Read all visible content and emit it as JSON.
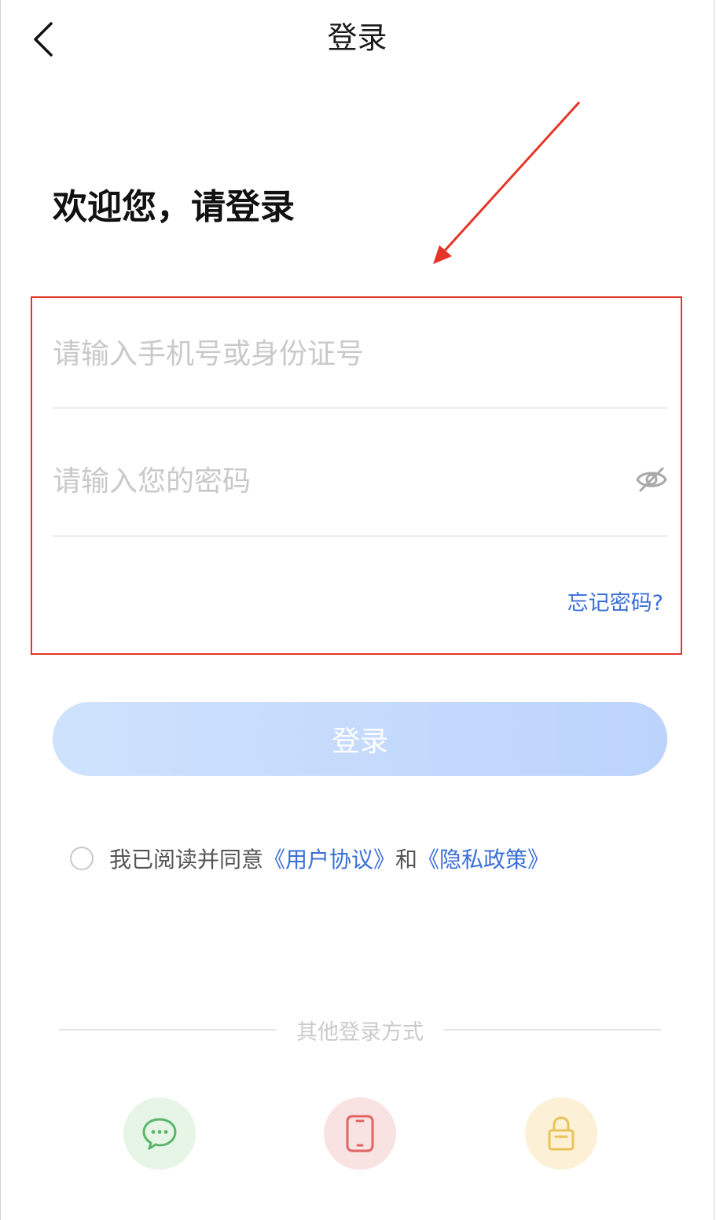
{
  "nav": {
    "title": "登录"
  },
  "welcome_text": "欢迎您，请登录",
  "form": {
    "phone_placeholder": "请输入手机号或身份证号",
    "phone_value": "",
    "password_placeholder": "请输入您的密码",
    "password_value": "",
    "forgot_label": "忘记密码?",
    "login_label": "登录"
  },
  "agreement": {
    "prefix": "我已阅读并同意",
    "user_agreement": "《用户协议》",
    "conjunction": "和",
    "privacy_policy": "《隐私政策》"
  },
  "other_login": {
    "label": "其他登录方式",
    "methods": [
      {
        "icon": "wechat-icon",
        "bg": "#e6f5e6",
        "color": "#5ab66b"
      },
      {
        "icon": "phone-icon",
        "bg": "#f9e2e2",
        "color": "#e06464"
      },
      {
        "icon": "lock-icon",
        "bg": "#fcf1d6",
        "color": "#eac25a"
      }
    ]
  },
  "colors": {
    "accent": "#3a6fd8",
    "highlight": "#e53528",
    "login_button": "#c7dbfd"
  }
}
